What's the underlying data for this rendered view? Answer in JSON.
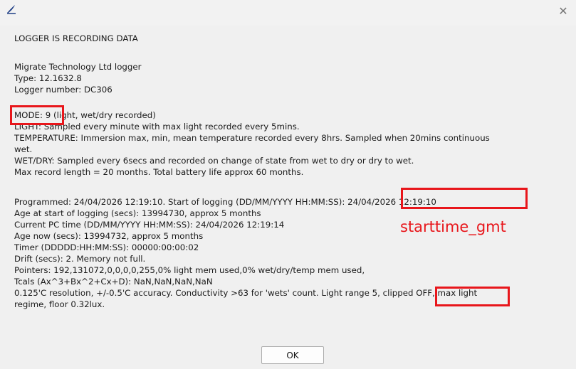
{
  "window": {
    "app_icon": "feather-logo-icon",
    "close_symbol": "✕"
  },
  "dialog": {
    "lines": [
      "LOGGER IS RECORDING DATA",
      "Migrate Technology Ltd logger",
      "Type: 12.1632.8",
      "Logger number: DC306",
      "MODE: 9 (light, wet/dry recorded)",
      "LIGHT: Sampled every minute with max light recorded every 5mins.",
      "TEMPERATURE: Immersion max, min, mean temperature recorded every 8hrs. Sampled when 20mins continuous",
      "wet.",
      "WET/DRY: Sampled every 6secs and recorded on change of state from wet to dry or dry to wet.",
      "Max record length = 20 months. Total battery life approx 60 months.",
      "Programmed: 24/04/2026 12:19:10. Start of logging (DD/MM/YYYY HH:MM:SS): 24/04/2026 12:19:10",
      "Age at start of logging (secs): 13994730, approx 5 months",
      "Current PC time (DD/MM/YYYY HH:MM:SS): 24/04/2026 12:19:14",
      "Age now (secs): 13994732, approx 5 months",
      "Timer (DDDDD:HH:MM:SS): 00000:00:00:02",
      "Drift (secs): 2. Memory not full.",
      "Pointers: 192,131072,0,0,0,0,255,0% light mem used,0% wet/dry/temp mem used,",
      "Tcals (Ax^3+Bx^2+Cx+D): NaN,NaN,NaN,NaN",
      "0.125'C resolution, +/-0.5'C accuracy. Conductivity >63 for 'wets' count. Light range 5, clipped OFF, max light",
      "regime, floor 0.32lux."
    ],
    "ok_label": "OK"
  },
  "annotations": {
    "starttime_label": "starttime_gmt",
    "color": "#e8161b"
  }
}
